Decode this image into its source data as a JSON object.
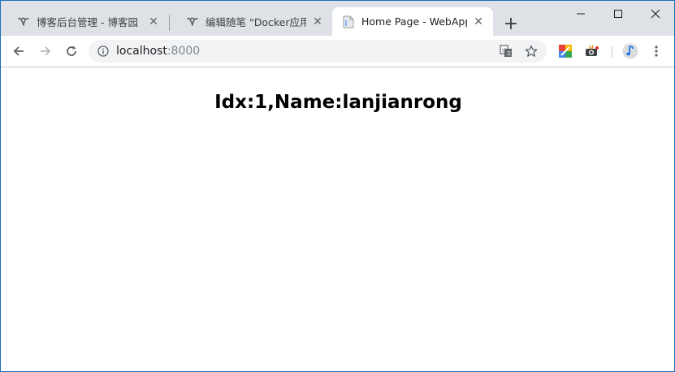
{
  "browser": {
    "tabs": [
      {
        "title": "博客后台管理 - 博客园",
        "active": false,
        "favicon": "cnblogs-icon"
      },
      {
        "title": "编辑随笔 \"Docker应用：",
        "active": false,
        "favicon": "cnblogs-icon"
      },
      {
        "title": "Home Page - WebApp",
        "active": true,
        "favicon": "page-icon"
      }
    ],
    "new_tab_label": "+",
    "address": {
      "host": "localhost",
      "port": ":8000"
    }
  },
  "page": {
    "heading": "Idx:1,Name:lanjianrong"
  },
  "colors": {
    "tabstrip": "#dee1e6",
    "omnibox": "#f1f3f4",
    "window_border": "#1a6fb8"
  }
}
